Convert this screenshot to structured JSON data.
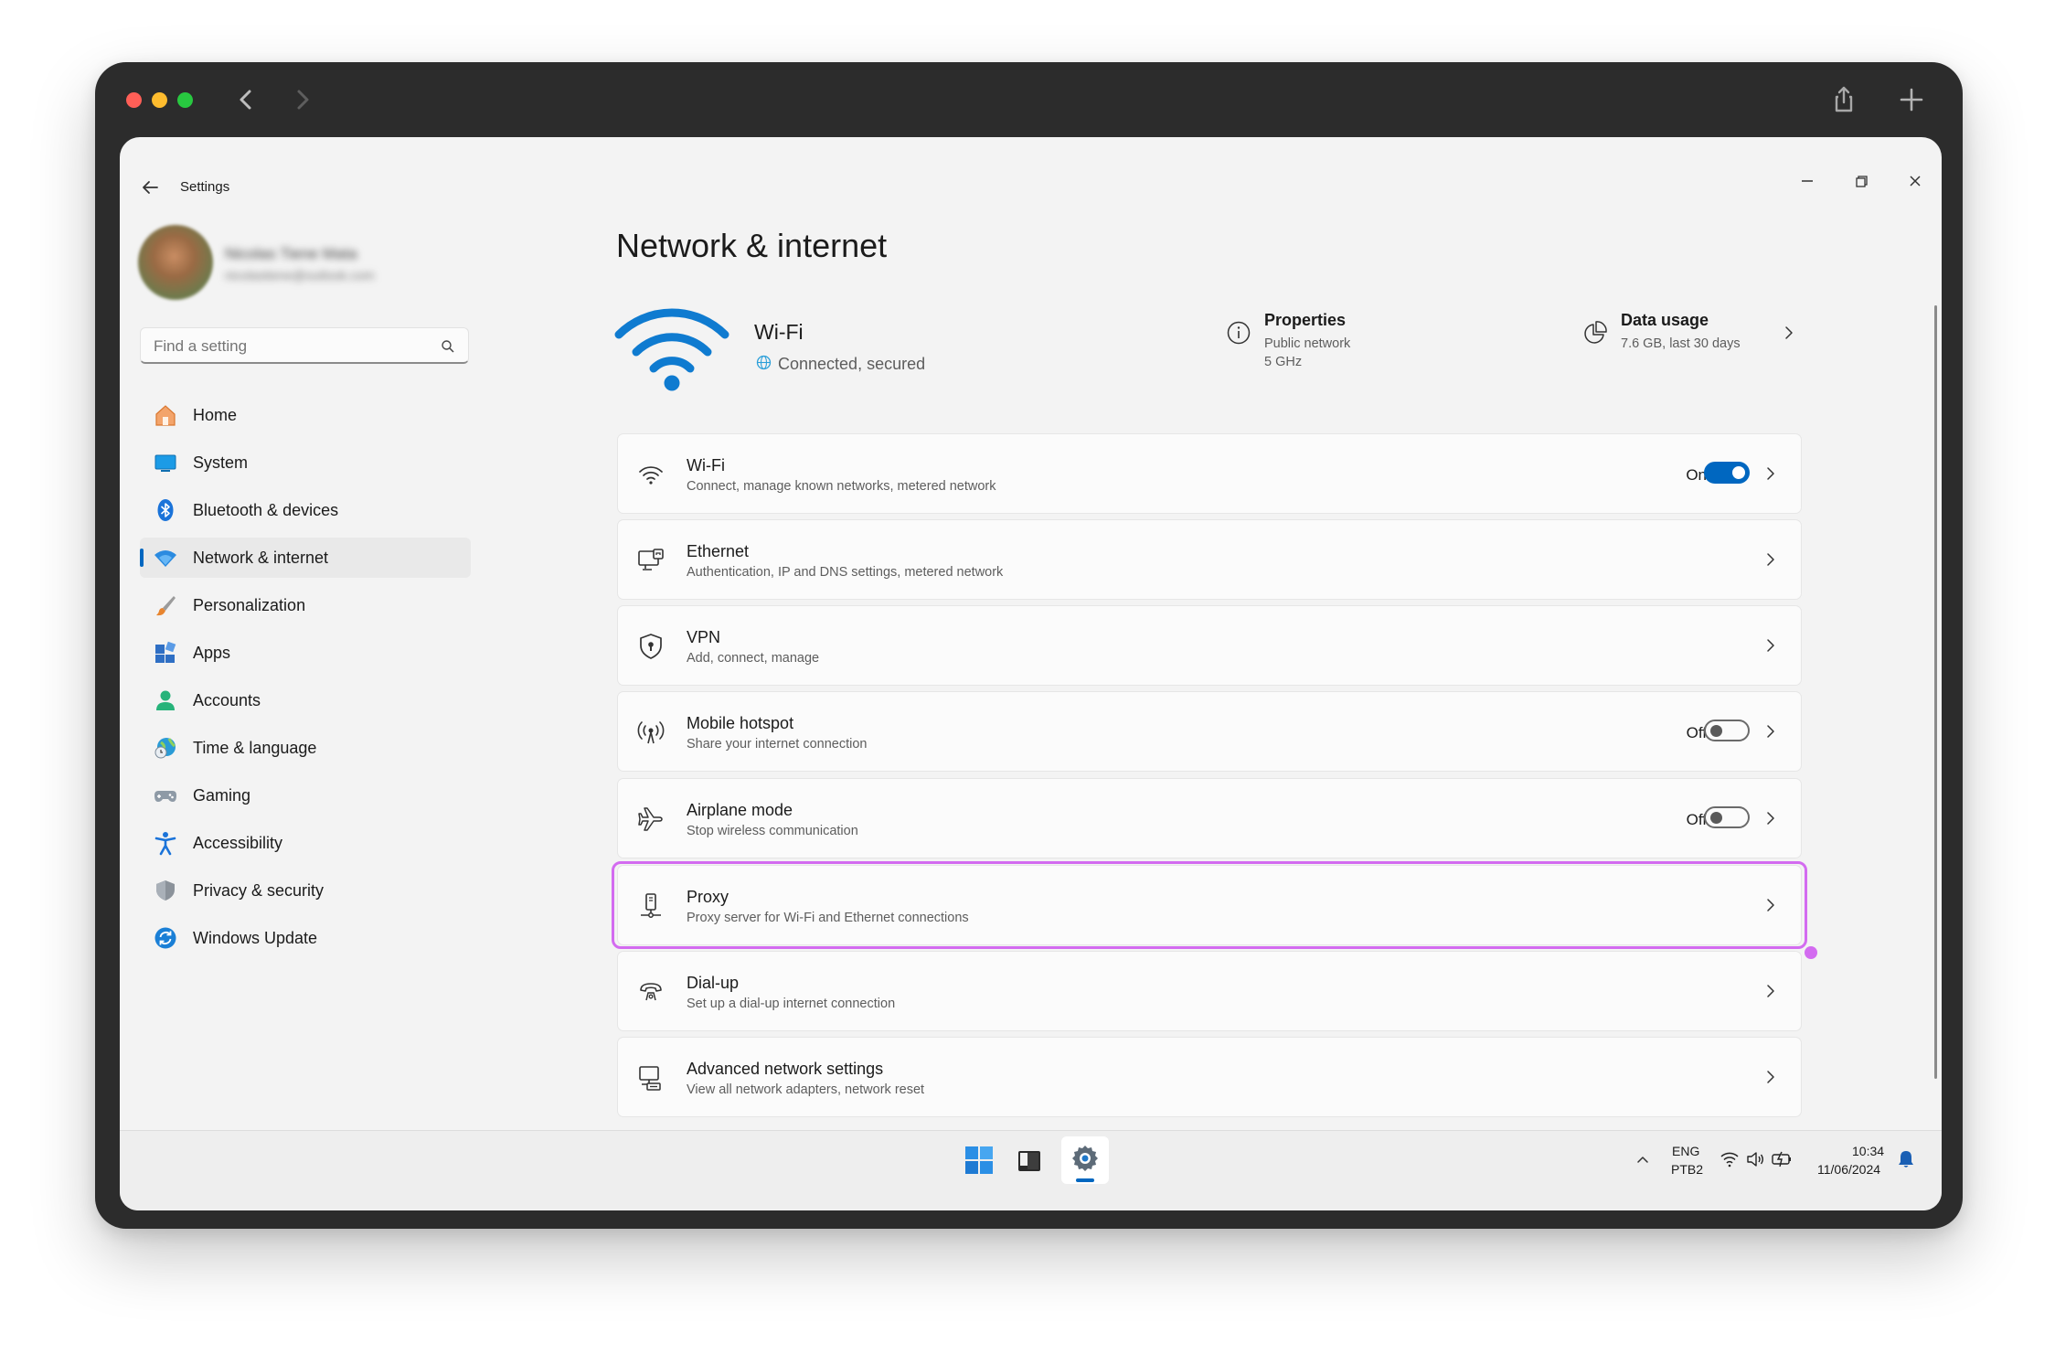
{
  "browser": {
    "traffic_light_colors": [
      "#ff5f57",
      "#febc2e",
      "#28c840"
    ]
  },
  "window": {
    "app_title": "Settings"
  },
  "user": {
    "name": "Nicolas Tiene Mata",
    "email": "nicolastiene@outlook.com"
  },
  "search": {
    "placeholder": "Find a setting"
  },
  "sidebar": {
    "items": [
      {
        "label": "Home",
        "icon": "home-icon"
      },
      {
        "label": "System",
        "icon": "system-icon"
      },
      {
        "label": "Bluetooth & devices",
        "icon": "bluetooth-icon"
      },
      {
        "label": "Network & internet",
        "icon": "network-icon",
        "active": true
      },
      {
        "label": "Personalization",
        "icon": "brush-icon"
      },
      {
        "label": "Apps",
        "icon": "apps-icon"
      },
      {
        "label": "Accounts",
        "icon": "accounts-icon"
      },
      {
        "label": "Time & language",
        "icon": "globe-clock-icon"
      },
      {
        "label": "Gaming",
        "icon": "gamepad-icon"
      },
      {
        "label": "Accessibility",
        "icon": "accessibility-icon"
      },
      {
        "label": "Privacy & security",
        "icon": "shield-icon"
      },
      {
        "label": "Windows Update",
        "icon": "update-icon"
      }
    ]
  },
  "main": {
    "title": "Network & internet",
    "status": {
      "name": "Wi-Fi",
      "connection": "Connected, secured",
      "properties": {
        "title": "Properties",
        "line1": "Public network",
        "line2": "5 GHz"
      },
      "data_usage": {
        "title": "Data usage",
        "line1": "7.6 GB, last 30 days"
      }
    },
    "cards": [
      {
        "title": "Wi-Fi",
        "subtitle": "Connect, manage known networks, metered network",
        "icon": "wifi-icon",
        "toggle_label": "On",
        "toggle_on": true
      },
      {
        "title": "Ethernet",
        "subtitle": "Authentication, IP and DNS settings, metered network",
        "icon": "ethernet-icon"
      },
      {
        "title": "VPN",
        "subtitle": "Add, connect, manage",
        "icon": "vpn-shield-icon"
      },
      {
        "title": "Mobile hotspot",
        "subtitle": "Share your internet connection",
        "icon": "hotspot-icon",
        "toggle_label": "Off",
        "toggle_on": false
      },
      {
        "title": "Airplane mode",
        "subtitle": "Stop wireless communication",
        "icon": "airplane-icon",
        "toggle_label": "Off",
        "toggle_on": false
      },
      {
        "title": "Proxy",
        "subtitle": "Proxy server for Wi-Fi and Ethernet connections",
        "icon": "proxy-icon"
      },
      {
        "title": "Dial-up",
        "subtitle": "Set up a dial-up internet connection",
        "icon": "dialup-icon"
      },
      {
        "title": "Advanced network settings",
        "subtitle": "View all network adapters, network reset",
        "icon": "advanced-network-icon"
      }
    ]
  },
  "taskbar": {
    "lang_line1": "ENG",
    "lang_line2": "PTB2",
    "time": "10:34",
    "date": "11/06/2024"
  },
  "colors": {
    "accent": "#0067c0",
    "highlight": "#d36bf0"
  }
}
